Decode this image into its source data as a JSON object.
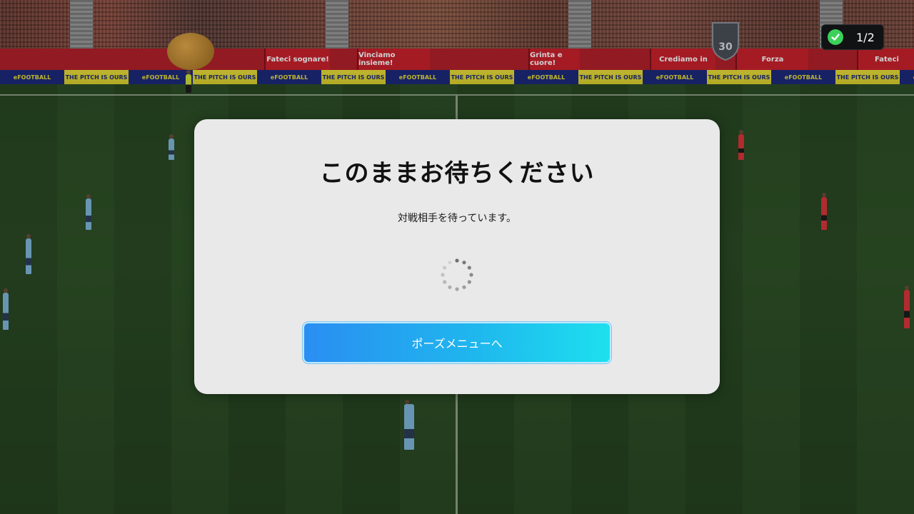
{
  "stadium": {
    "ad_boards": [
      "Fateci sognare!",
      "Vinciamo insieme!",
      "Grinta e cuore!",
      "Crediamo in",
      "Forza",
      "Fateci"
    ],
    "led_text_a": "THE PITCH IS OURS",
    "led_text_b": "eFOOTBALL",
    "anniversary_badge": "30"
  },
  "progress_badge": {
    "count": "1/2",
    "accent_color": "#3bd15a",
    "icon": "check-circle-icon"
  },
  "dialog": {
    "title": "このままお待ちください",
    "message": "対戦相手を待っています。",
    "button_label": "ポーズメニューへ",
    "spinner_icon": "loading-spinner-icon",
    "button_gradient": [
      "#2a8ef2",
      "#1ee0ee"
    ]
  },
  "players": {
    "home_kit_color": "#7fb6d9",
    "away_kit_color": "#d8353a"
  }
}
